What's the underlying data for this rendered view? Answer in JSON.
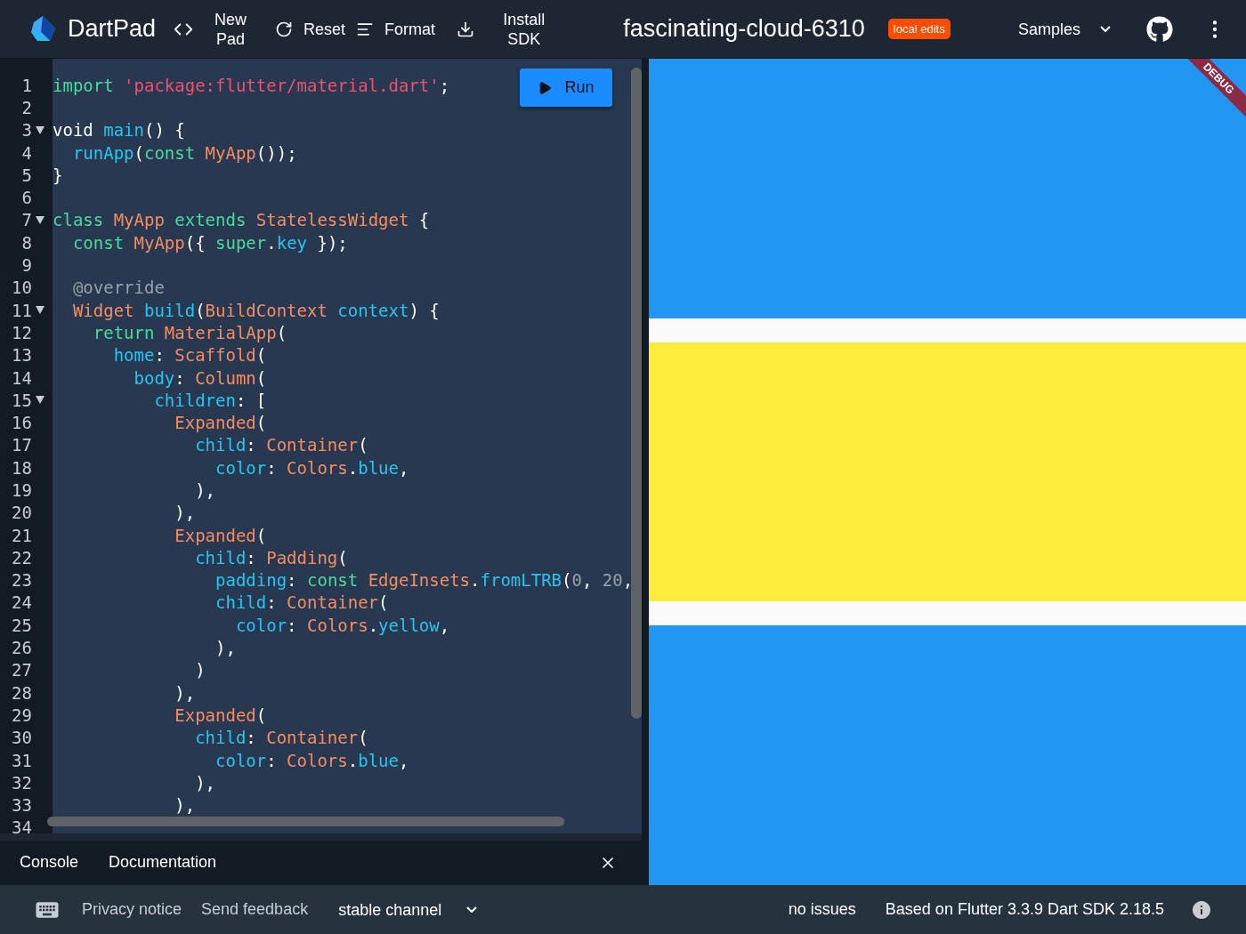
{
  "header": {
    "logo": "DartPad",
    "new_pad": "New\nPad",
    "reset": "Reset",
    "format": "Format",
    "install_sdk": "Install\nSDK",
    "title": "fascinating-cloud-6310",
    "badge": "local edits",
    "samples": "Samples"
  },
  "editor": {
    "run": "Run",
    "lines": [
      {
        "n": "1",
        "fold": false,
        "code": [
          {
            "kind": "keyword",
            "text": "import"
          },
          {
            "kind": "string",
            "text": " 'package:flutter/material.dart'"
          },
          {
            "kind": "plain",
            "text": ";"
          }
        ]
      },
      {
        "n": "2",
        "fold": false
      },
      {
        "n": "3",
        "fold": true,
        "code": [
          {
            "kind": "plain",
            "text": "void"
          },
          {
            "kind": "function",
            "text": " main"
          },
          {
            "kind": "plain",
            "text": "() {"
          }
        ]
      },
      {
        "n": "4",
        "fold": false,
        "code": [
          {
            "kind": "function",
            "text": "  runApp"
          },
          {
            "kind": "plain",
            "text": "("
          },
          {
            "kind": "keyword",
            "text": "const"
          },
          {
            "kind": "class",
            "text": " MyApp"
          },
          {
            "kind": "plain",
            "text": "());"
          }
        ]
      },
      {
        "n": "5",
        "fold": false,
        "code": [
          {
            "kind": "plain",
            "text": "}"
          }
        ]
      },
      {
        "n": "6",
        "fold": false
      },
      {
        "n": "7",
        "fold": true,
        "code": [
          {
            "kind": "keyword",
            "text": "class"
          },
          {
            "kind": "class",
            "text": " MyApp"
          },
          {
            "kind": "keyword",
            "text": " extends"
          },
          {
            "kind": "class",
            "text": " StatelessWidget"
          },
          {
            "kind": "plain",
            "text": " {"
          }
        ]
      },
      {
        "n": "8",
        "fold": false,
        "code": [
          {
            "kind": "keyword",
            "text": "  const"
          },
          {
            "kind": "class",
            "text": " MyApp"
          },
          {
            "kind": "plain",
            "text": "({"
          },
          {
            "kind": "keyword",
            "text": " super"
          },
          {
            "kind": "plain",
            "text": "."
          },
          {
            "kind": "function",
            "text": "key"
          },
          {
            "kind": "plain",
            "text": " });"
          }
        ]
      },
      {
        "n": "9",
        "fold": false
      },
      {
        "n": "10",
        "fold": false,
        "code": [
          {
            "kind": "comment",
            "text": "  @override"
          }
        ]
      },
      {
        "n": "11",
        "fold": true,
        "code": [
          {
            "kind": "class",
            "text": "  Widget"
          },
          {
            "kind": "function",
            "text": " build"
          },
          {
            "kind": "plain",
            "text": "("
          },
          {
            "kind": "class",
            "text": "BuildContext"
          },
          {
            "kind": "function",
            "text": " context"
          },
          {
            "kind": "plain",
            "text": ") {"
          }
        ]
      },
      {
        "n": "12",
        "fold": false,
        "code": [
          {
            "kind": "keyword",
            "text": "    return"
          },
          {
            "kind": "class",
            "text": " MaterialApp"
          },
          {
            "kind": "plain",
            "text": "("
          }
        ]
      },
      {
        "n": "13",
        "fold": false,
        "code": [
          {
            "kind": "function",
            "text": "      home"
          },
          {
            "kind": "plain",
            "text": ":"
          },
          {
            "kind": "class",
            "text": " Scaffold"
          },
          {
            "kind": "plain",
            "text": "("
          }
        ]
      },
      {
        "n": "14",
        "fold": false,
        "code": [
          {
            "kind": "function",
            "text": "        body"
          },
          {
            "kind": "plain",
            "text": ":"
          },
          {
            "kind": "class",
            "text": " Column"
          },
          {
            "kind": "plain",
            "text": "("
          }
        ]
      },
      {
        "n": "15",
        "fold": true,
        "code": [
          {
            "kind": "function",
            "text": "          children"
          },
          {
            "kind": "plain",
            "text": ": ["
          }
        ]
      },
      {
        "n": "16",
        "fold": false,
        "code": [
          {
            "kind": "class",
            "text": "            Expanded"
          },
          {
            "kind": "plain",
            "text": "("
          }
        ]
      },
      {
        "n": "17",
        "fold": false,
        "code": [
          {
            "kind": "function",
            "text": "              child"
          },
          {
            "kind": "plain",
            "text": ":"
          },
          {
            "kind": "class",
            "text": " Container"
          },
          {
            "kind": "plain",
            "text": "("
          }
        ]
      },
      {
        "n": "18",
        "fold": false,
        "code": [
          {
            "kind": "function",
            "text": "                color"
          },
          {
            "kind": "plain",
            "text": ":"
          },
          {
            "kind": "class",
            "text": " Colors"
          },
          {
            "kind": "plain",
            "text": "."
          },
          {
            "kind": "function",
            "text": "blue"
          },
          {
            "kind": "plain",
            "text": ","
          }
        ]
      },
      {
        "n": "19",
        "fold": false,
        "code": [
          {
            "kind": "plain",
            "text": "              ),"
          }
        ]
      },
      {
        "n": "20",
        "fold": false,
        "code": [
          {
            "kind": "plain",
            "text": "            ),"
          }
        ]
      },
      {
        "n": "21",
        "fold": false,
        "code": [
          {
            "kind": "class",
            "text": "            Expanded"
          },
          {
            "kind": "plain",
            "text": "("
          }
        ]
      },
      {
        "n": "22",
        "fold": false,
        "code": [
          {
            "kind": "function",
            "text": "              child"
          },
          {
            "kind": "plain",
            "text": ":"
          },
          {
            "kind": "class",
            "text": " Padding"
          },
          {
            "kind": "plain",
            "text": "("
          }
        ]
      },
      {
        "n": "23",
        "fold": false,
        "code": [
          {
            "kind": "function",
            "text": "                padding"
          },
          {
            "kind": "plain",
            "text": ":"
          },
          {
            "kind": "keyword",
            "text": " const"
          },
          {
            "kind": "class",
            "text": " EdgeInsets"
          },
          {
            "kind": "plain",
            "text": "."
          },
          {
            "kind": "function",
            "text": "fromLTRB"
          },
          {
            "kind": "plain",
            "text": "("
          },
          {
            "kind": "number",
            "text": "0"
          },
          {
            "kind": "plain",
            "text": ","
          },
          {
            "kind": "number",
            "text": " 20"
          },
          {
            "kind": "plain",
            "text": ","
          }
        ]
      },
      {
        "n": "24",
        "fold": false,
        "code": [
          {
            "kind": "function",
            "text": "                child"
          },
          {
            "kind": "plain",
            "text": ":"
          },
          {
            "kind": "class",
            "text": " Container"
          },
          {
            "kind": "plain",
            "text": "("
          }
        ]
      },
      {
        "n": "25",
        "fold": false,
        "code": [
          {
            "kind": "function",
            "text": "                  color"
          },
          {
            "kind": "plain",
            "text": ":"
          },
          {
            "kind": "class",
            "text": " Colors"
          },
          {
            "kind": "plain",
            "text": "."
          },
          {
            "kind": "function",
            "text": "yellow"
          },
          {
            "kind": "plain",
            "text": ","
          }
        ]
      },
      {
        "n": "26",
        "fold": false,
        "code": [
          {
            "kind": "plain",
            "text": "                ),"
          }
        ]
      },
      {
        "n": "27",
        "fold": false,
        "code": [
          {
            "kind": "plain",
            "text": "              )"
          }
        ]
      },
      {
        "n": "28",
        "fold": false,
        "code": [
          {
            "kind": "plain",
            "text": "            ),"
          }
        ]
      },
      {
        "n": "29",
        "fold": false,
        "code": [
          {
            "kind": "class",
            "text": "            Expanded"
          },
          {
            "kind": "plain",
            "text": "("
          }
        ]
      },
      {
        "n": "30",
        "fold": false,
        "code": [
          {
            "kind": "function",
            "text": "              child"
          },
          {
            "kind": "plain",
            "text": ":"
          },
          {
            "kind": "class",
            "text": " Container"
          },
          {
            "kind": "plain",
            "text": "("
          }
        ]
      },
      {
        "n": "31",
        "fold": false,
        "code": [
          {
            "kind": "function",
            "text": "                color"
          },
          {
            "kind": "plain",
            "text": ":"
          },
          {
            "kind": "class",
            "text": " Colors"
          },
          {
            "kind": "plain",
            "text": "."
          },
          {
            "kind": "function",
            "text": "blue"
          },
          {
            "kind": "plain",
            "text": ","
          }
        ]
      },
      {
        "n": "32",
        "fold": false,
        "code": [
          {
            "kind": "plain",
            "text": "              ),"
          }
        ]
      },
      {
        "n": "33",
        "fold": false,
        "code": [
          {
            "kind": "plain",
            "text": "            ),"
          }
        ]
      },
      {
        "n": "34",
        "fold": false
      }
    ]
  },
  "console_tabs": [
    {
      "label": "Console",
      "selected": false
    },
    {
      "label": "Documentation",
      "selected": false
    }
  ],
  "preview": {
    "debug_banner": "DEBUG",
    "bands": [
      {
        "kind": "fill",
        "color": "#2196f3"
      },
      {
        "kind": "gap",
        "color": "#fafafa"
      },
      {
        "kind": "fill",
        "color": "#ffeb3b"
      },
      {
        "kind": "gap",
        "color": "#fafafa"
      },
      {
        "kind": "fill",
        "color": "#2196f3"
      }
    ]
  },
  "footer": {
    "privacy": "Privacy notice",
    "feedback": "Send feedback",
    "channel": "stable channel",
    "issues": "no issues",
    "version": "Based on Flutter 3.3.9 Dart SDK 2.18.5"
  }
}
